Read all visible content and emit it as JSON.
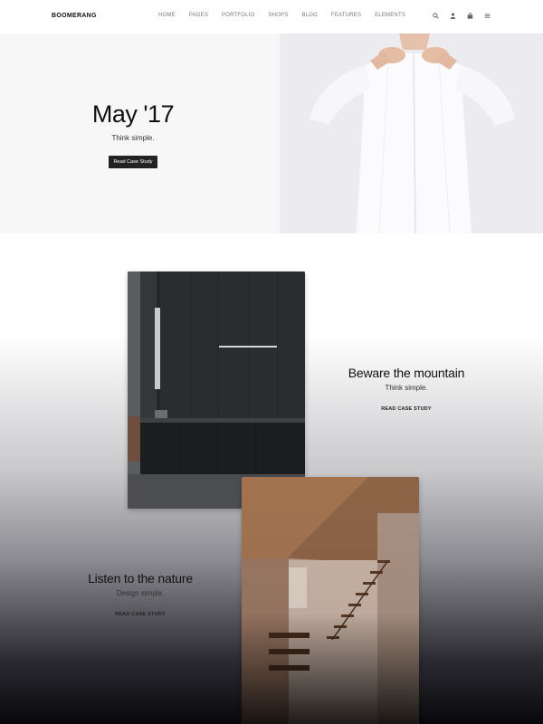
{
  "header": {
    "logo": "BOOMERANG",
    "nav": [
      {
        "label": "HOME"
      },
      {
        "label": "PAGES"
      },
      {
        "label": "PORTFOLIO"
      },
      {
        "label": "SHOPS"
      },
      {
        "label": "BLOG"
      },
      {
        "label": "FEATURES"
      },
      {
        "label": "ELEMENTS"
      }
    ],
    "icons": [
      "search-icon",
      "user-icon",
      "cart-icon",
      "menu-icon"
    ]
  },
  "hero": {
    "title": "May '17",
    "subtitle": "Think simple.",
    "button_label": "Read Case Study",
    "image": "man-in-white-shirt"
  },
  "cases": [
    {
      "title": "Beware the mountain",
      "subtitle": "Think simple.",
      "link_label": "READ CASE STUDY",
      "image": "dark-kitchen"
    },
    {
      "title": "Listen to the nature",
      "subtitle": "Design simple.",
      "link_label": "READ CASE STUDY",
      "image": "wooden-staircase"
    }
  ],
  "colors": {
    "button_bg": "#222222",
    "text": "#111111",
    "nav_text": "#777777"
  }
}
